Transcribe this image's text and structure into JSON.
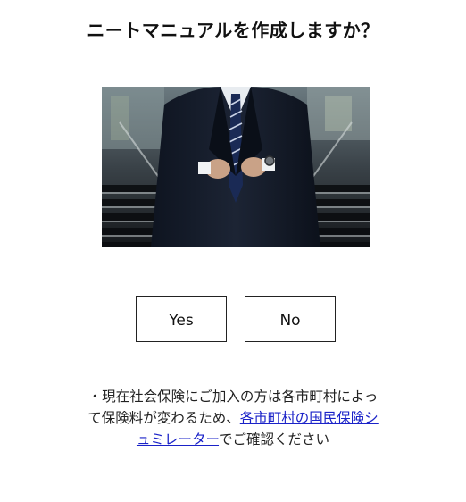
{
  "page": {
    "title": "ニートマニュアルを作成しますか？"
  },
  "hero_image": {
    "subject": "businessman-in-suit-on-stairs"
  },
  "choices": {
    "yes_label": "Yes",
    "no_label": "No"
  },
  "note": {
    "prefix": "・現在社会保険にご加入の方は各市町村によって保険料が変わるため、",
    "link_text": "各市町村の国民保険シュミレーター",
    "suffix": "でご確認ください"
  },
  "colors": {
    "link": "#1a22c8",
    "text": "#111111",
    "button_border": "#222222"
  }
}
